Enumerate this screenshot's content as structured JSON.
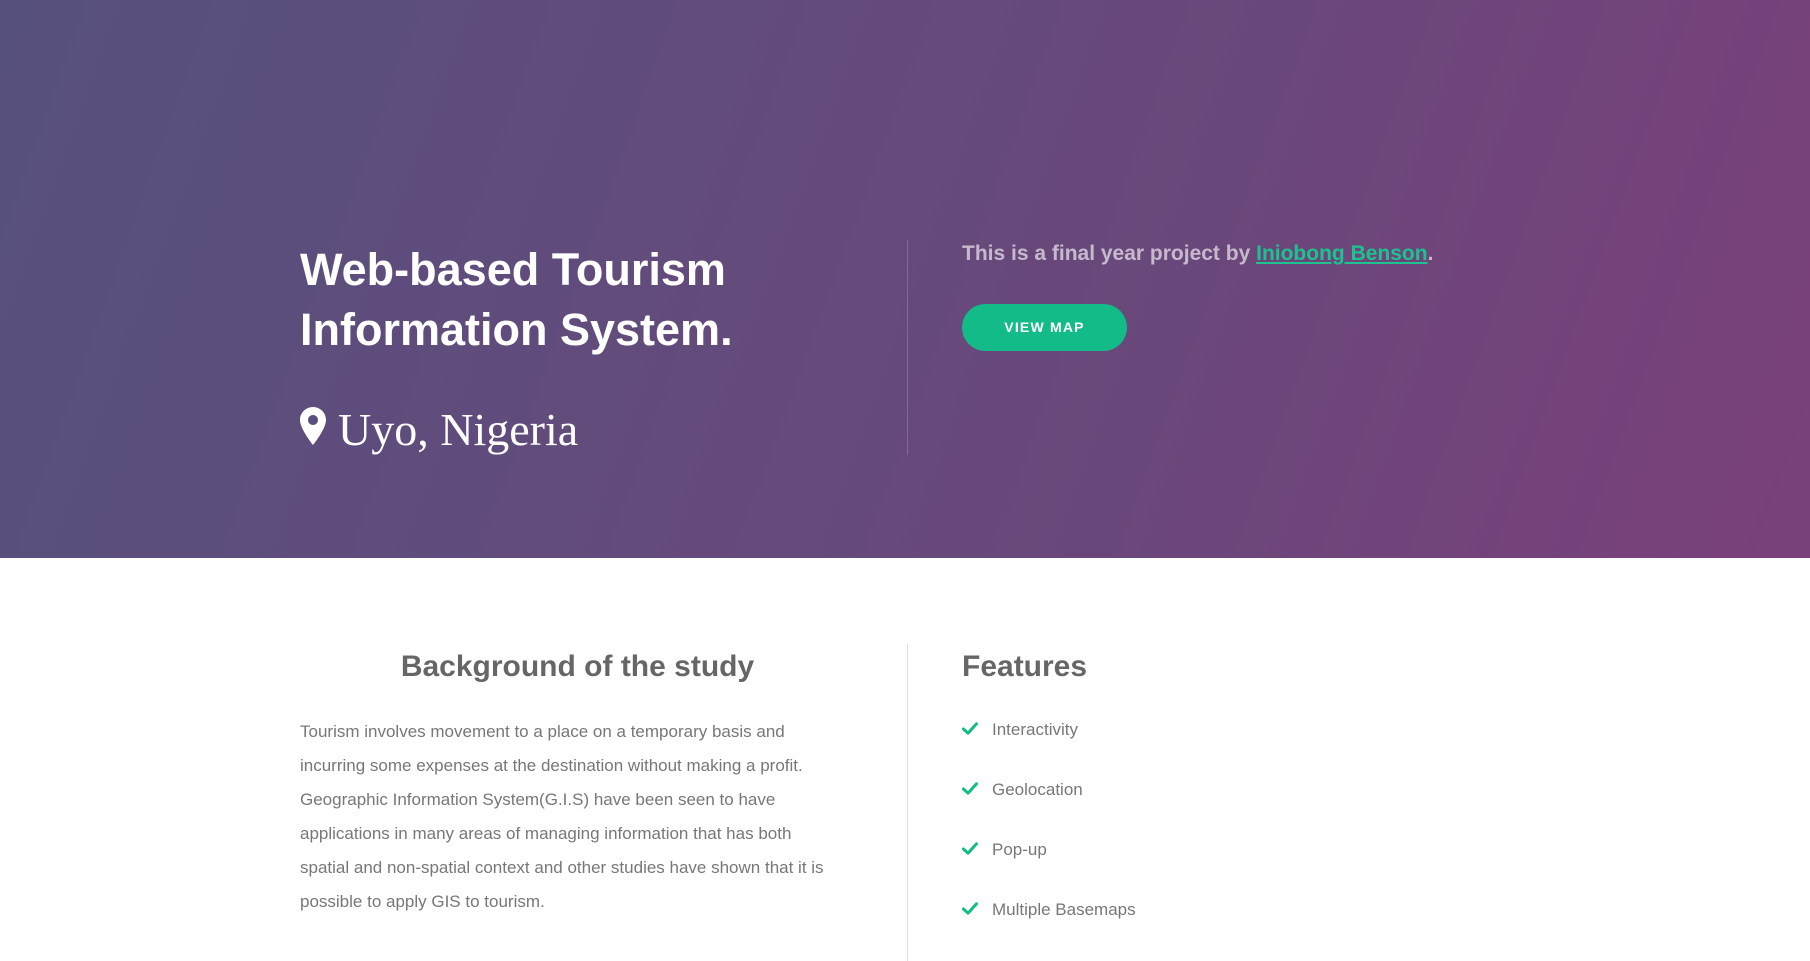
{
  "hero": {
    "title": "Web-based Tourism Information System.",
    "location": "Uyo, Nigeria",
    "location_icon": "map-marker-icon",
    "byline_prefix": "This is a final year project by ",
    "author_name": "Iniobong Benson",
    "byline_suffix": ".",
    "view_map_label": "VIEW MAP"
  },
  "background": {
    "heading": "Background of the study",
    "text": "Tourism involves movement to a place on a temporary basis and incurring some expenses at the destination without making a profit. Geographic Information System(G.I.S) have been seen to have applications in many areas of managing information that has both spatial and non-spatial context and other studies have shown that it is possible to apply GIS to tourism."
  },
  "features": {
    "heading": "Features",
    "item_icon": "check-icon",
    "items": [
      {
        "label": "Interactivity"
      },
      {
        "label": "Geolocation"
      },
      {
        "label": "Pop-up"
      },
      {
        "label": "Multiple Basemaps"
      }
    ]
  },
  "colors": {
    "accent": "#12bb88",
    "hero_gradient_start": "#56507d",
    "hero_gradient_end": "#7a4079",
    "text_muted": "#777777",
    "heading": "#666666"
  }
}
